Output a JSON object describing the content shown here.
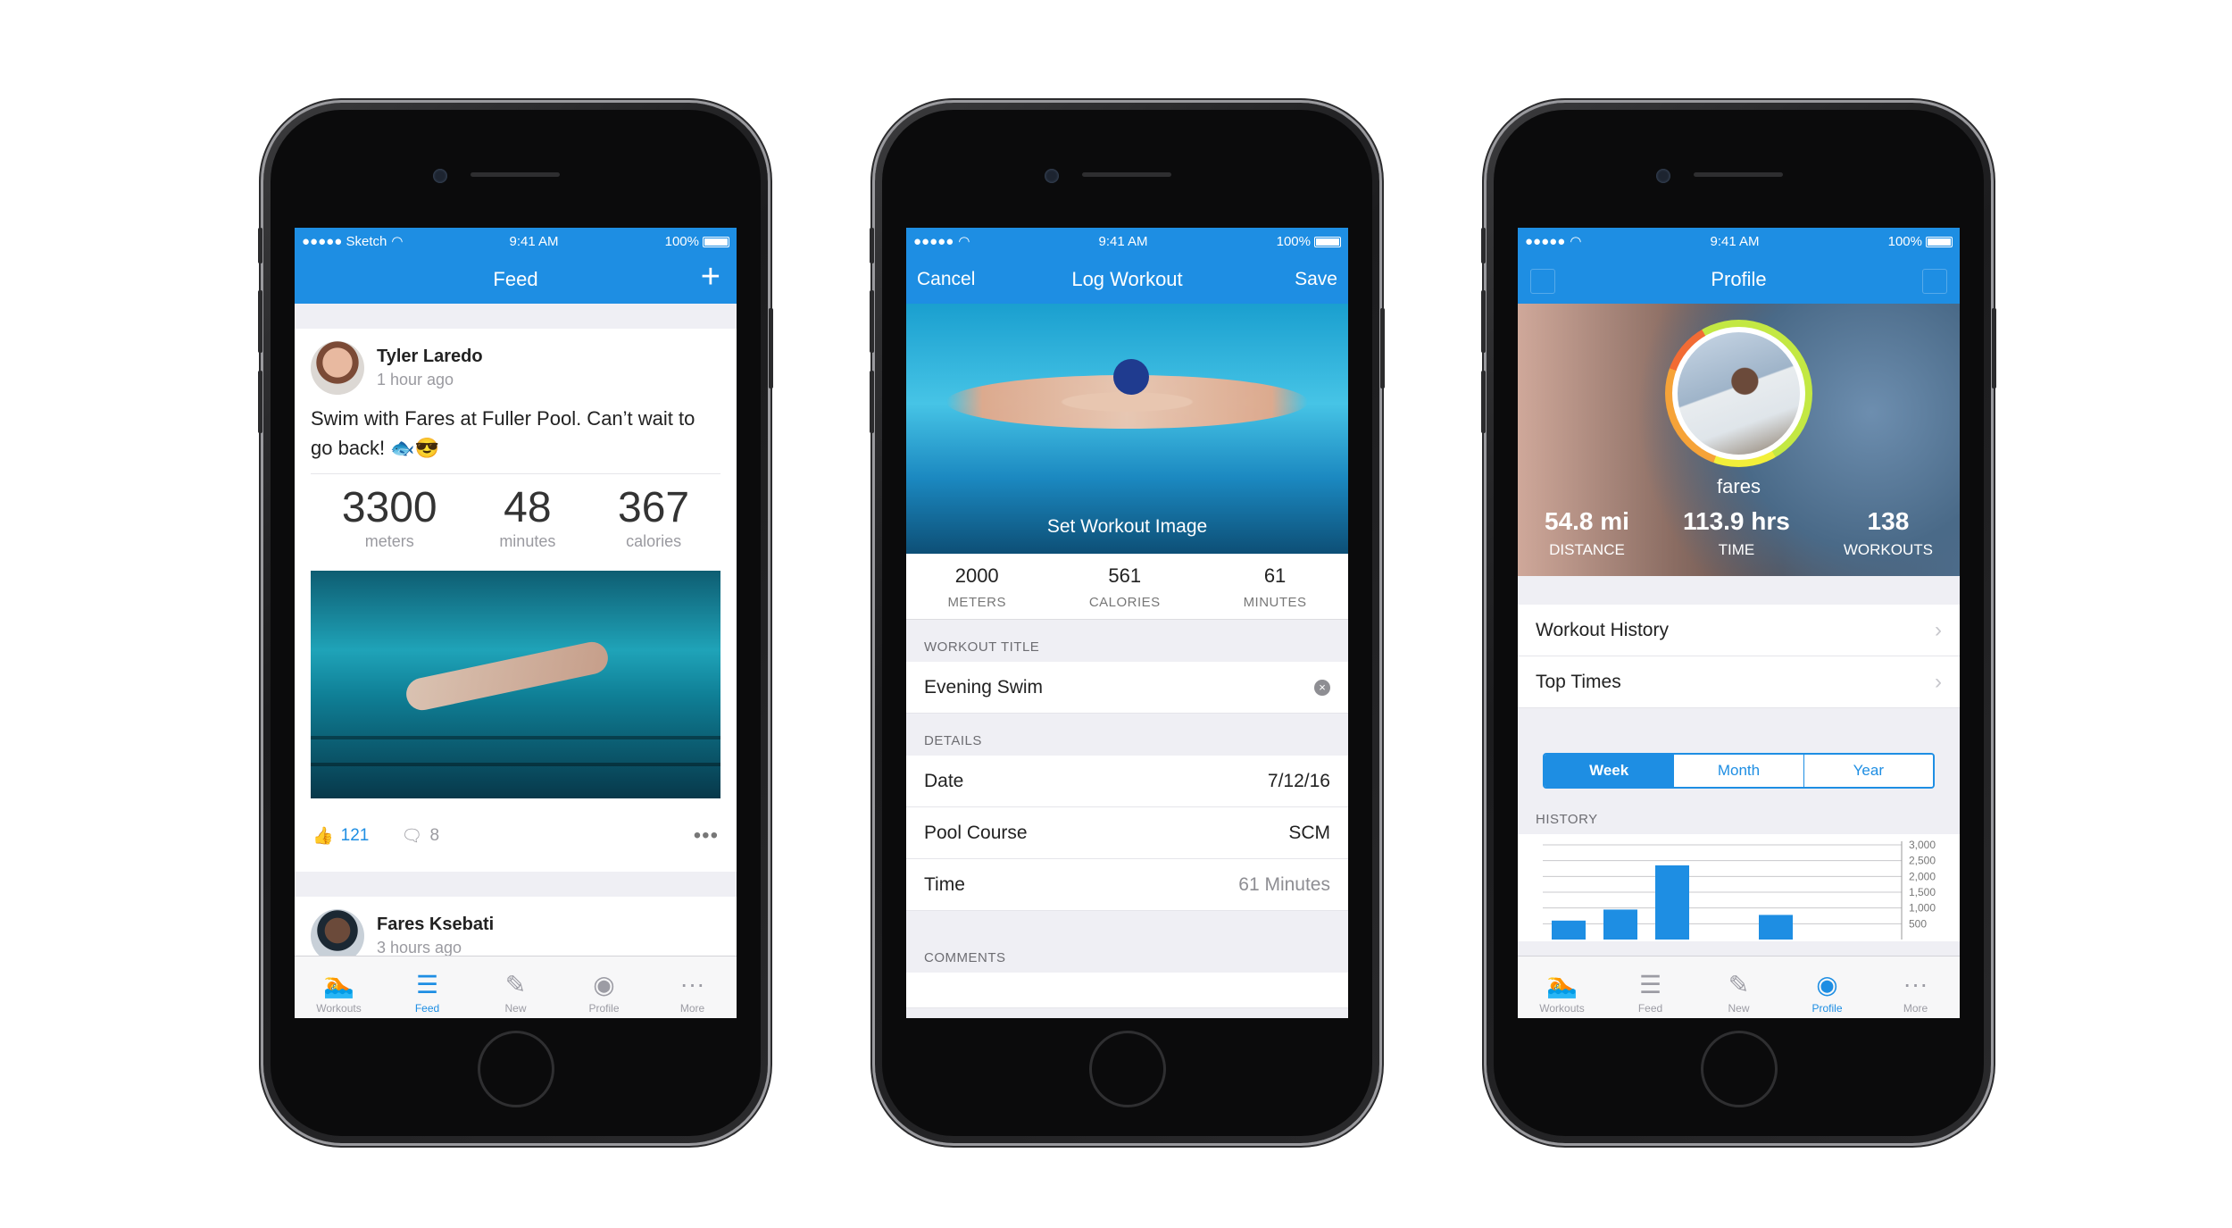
{
  "colors": {
    "accent": "#1e8ee3",
    "background": "#efeff4"
  },
  "phones": {
    "feed": {
      "status": {
        "carrier": "●●●●● Sketch",
        "time": "9:41 AM",
        "battery": "100%"
      },
      "nav": {
        "title": "Feed",
        "add_icon": "plus-icon"
      },
      "posts": [
        {
          "author": "Tyler Laredo",
          "time": "1 hour ago",
          "text": "Swim with Fares at Fuller Pool. Can’t wait to go back! 🐟😎",
          "stats": [
            {
              "value": "3300",
              "label": "meters"
            },
            {
              "value": "48",
              "label": "minutes"
            },
            {
              "value": "367",
              "label": "calories"
            }
          ],
          "likes": "121",
          "comments": "8"
        },
        {
          "author": "Fares Ksebati",
          "time": "3 hours ago"
        }
      ],
      "tabs": [
        "Workouts",
        "Feed",
        "New",
        "Profile",
        "More"
      ]
    },
    "log": {
      "status": {
        "carrier": "●●●●●",
        "time": "9:41 AM",
        "battery": "100%"
      },
      "nav": {
        "cancel": "Cancel",
        "title": "Log Workout",
        "save": "Save"
      },
      "hero_label": "Set Workout Image",
      "stats": [
        {
          "value": "2000",
          "label": "METERS"
        },
        {
          "value": "561",
          "label": "CALORIES"
        },
        {
          "value": "61",
          "label": "MINUTES"
        }
      ],
      "title_section": "WORKOUT TITLE",
      "title_value": "Evening Swim",
      "details_section": "DETAILS",
      "details": [
        {
          "label": "Date",
          "value": "7/12/16"
        },
        {
          "label": "Pool Course",
          "value": "SCM"
        },
        {
          "label": "Time",
          "value": "61 Minutes"
        }
      ],
      "comments_section": "COMMENTS"
    },
    "profile": {
      "status": {
        "carrier": "●●●●●",
        "time": "9:41 AM",
        "battery": "100%"
      },
      "nav": {
        "title": "Profile"
      },
      "name": "fares",
      "stats": [
        {
          "value": "54.8 mi",
          "label": "DISTANCE"
        },
        {
          "value": "113.9 hrs",
          "label": "TIME"
        },
        {
          "value": "138",
          "label": "WORKOUTS"
        }
      ],
      "menu": [
        "Workout History",
        "Top Times"
      ],
      "segments": [
        "Week",
        "Month",
        "Year"
      ],
      "history_label": "HISTORY",
      "tabs": [
        "Workouts",
        "Feed",
        "New",
        "Profile",
        "More"
      ]
    }
  },
  "chart_data": {
    "type": "bar",
    "title": "HISTORY",
    "yticks": [
      "3,000",
      "2,500",
      "2,000",
      "1,500",
      "1,000",
      "500"
    ],
    "ylim": [
      0,
      3000
    ],
    "values": [
      600,
      950,
      2350,
      0,
      780
    ],
    "grid": true
  }
}
